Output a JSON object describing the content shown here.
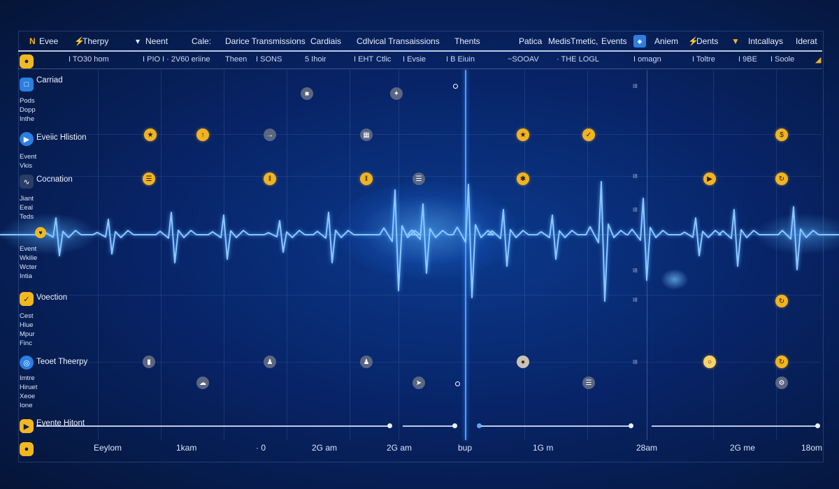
{
  "topbar": {
    "items": [
      "Evee",
      "Therpy",
      "Neent",
      "Cale:",
      "Darice Transmissions",
      "Cardiais",
      "Cdlvical Transaissions",
      "Thents",
      "Patica",
      "MedisTmetic,",
      "Events",
      "Aniem",
      "Dents",
      "Intcallays",
      "Iderat"
    ]
  },
  "subbar": {
    "items": [
      "I TO30 hom",
      "I PIO",
      "I · 2V60 eriine",
      "Theen",
      "I SONS",
      "5 Ihoir",
      "I EHT",
      "Ctlic",
      "I Evsie",
      "I B Eiuin",
      "~SOOAV",
      "· THE LOGL",
      "I omagn",
      "I Toltre",
      "I 9BE",
      "I Soole"
    ]
  },
  "sidebar": {
    "sections": [
      {
        "title": "Carriad",
        "sub": [
          "Pods",
          "Dopp",
          "Inthe"
        ]
      },
      {
        "title": "Eveiic Hlistion",
        "sub": [
          "Event",
          "Vkis"
        ]
      },
      {
        "title": "Cocnation",
        "sub": [
          "Jiant",
          "Eeal",
          "Teds"
        ]
      },
      {
        "title": "",
        "sub": [
          "Event",
          "Wkilie",
          "Wcter",
          "Intia"
        ]
      },
      {
        "title": "Voection",
        "sub": [
          "Cest",
          "Hlue",
          "Mpur",
          "Finc"
        ]
      },
      {
        "title": "Teoet Theerpy",
        "sub": [
          "Imtre",
          "Hiruet",
          "Xeoe",
          "Ione"
        ]
      },
      {
        "title": "Evente Hitont",
        "sub": []
      }
    ]
  },
  "axis": {
    "right_ticks": [
      "I8",
      "I8",
      "I8",
      "I8",
      "I8",
      "I8",
      "I8"
    ]
  },
  "bottom_labels": [
    "Eeylom",
    "1kam",
    "· 0",
    "2G am",
    "2G am",
    "bup",
    "1G m",
    "28am",
    "2G me",
    "18om"
  ],
  "colors": {
    "accent": "#f0b323",
    "line": "#6fb5ff",
    "bg": "#08256a"
  }
}
